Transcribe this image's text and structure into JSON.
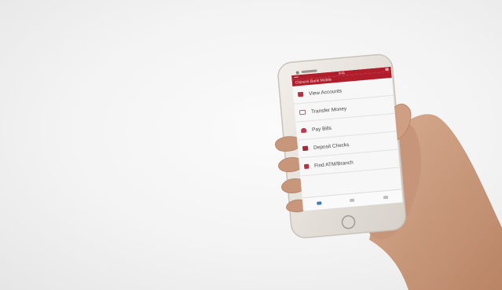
{
  "app": {
    "status_left": "••••",
    "status_center": "9:41",
    "status_right": "▮▮",
    "header_title": "Citizens Bank Mobile"
  },
  "menu_items": [
    {
      "label": "View Accounts",
      "icon": "card-icon"
    },
    {
      "label": "Transfer Money",
      "icon": "envelope-icon"
    },
    {
      "label": "Pay Bills",
      "icon": "person-icon"
    },
    {
      "label": "Deposit Checks",
      "icon": "tower-icon"
    },
    {
      "label": "Find ATM/Branch",
      "icon": "atm-icon"
    }
  ],
  "tabs": [
    {
      "icon": "home-icon",
      "active": true
    },
    {
      "icon": "lock-icon",
      "active": false
    },
    {
      "icon": "more-icon",
      "active": false
    }
  ],
  "colors": {
    "brand": "#b01e2c",
    "background": "#f3f3f3",
    "skin": "#c99a7d",
    "phone_body": "#e7e2dc"
  }
}
